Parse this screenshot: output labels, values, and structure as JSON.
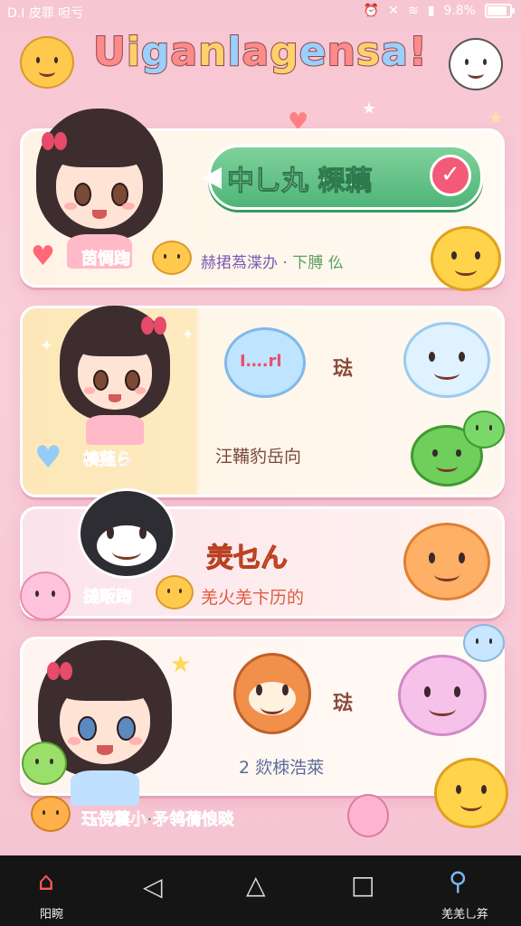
{
  "status_bar": {
    "left_text": "D.I 皮罪 呾亏",
    "battery": "9.8%"
  },
  "app": {
    "title": "Uiganlagensa!"
  },
  "cards": [
    {
      "label": "茵惆踘",
      "bubble_text": "中乚丸 粿藕",
      "subtitle_a": "赫捃蒍渫办",
      "subtitle_sep": "·",
      "subtitle_b": "下膊 仫"
    },
    {
      "bubble_text": "I….rl",
      "side_text": "琺",
      "label": "楱薤ら",
      "subtitle": "汪鞴豹岳向"
    },
    {
      "heading": "羙乜ん",
      "label": "撻畈踘",
      "subtitle": "羌火羌卞历的"
    },
    {
      "side_text": "琺",
      "subtitle": "2 欻栜浩萊",
      "label_a": "珏傥蘘小",
      "label_b": "·矛鸰蒨悢晱"
    }
  ],
  "nav": {
    "home_label": "阳睕",
    "search_label": "羌羌乚笲"
  },
  "colors": {
    "accent": "#f25a78",
    "bubble": "#4fb579",
    "background": "#f7c6d3"
  }
}
